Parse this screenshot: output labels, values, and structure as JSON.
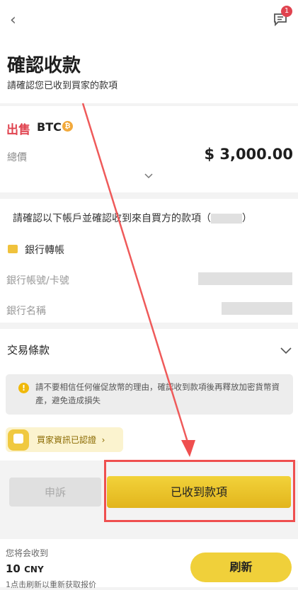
{
  "header": {
    "back_glyph": "‹",
    "chat_badge": "1"
  },
  "page": {
    "title": "確認收款",
    "subtitle": "請確認您已收到買家的款項"
  },
  "order": {
    "side": "出售",
    "coin": "BTC",
    "coin_symbol": "₿",
    "total_label": "總價",
    "total_value": "$  3,000.00"
  },
  "payment": {
    "confirm_text": "請確認以下帳戶並確認收到來自買方的款項（",
    "confirm_text_end": "）",
    "method": "銀行轉帳",
    "account_label": "銀行帳號/卡號",
    "bank_name_label": "銀行名稱"
  },
  "terms": {
    "label": "交易條款"
  },
  "notice": {
    "icon_glyph": "!",
    "text": "請不要相信任何催促放幣的理由，確認收到款項後再釋放加密貨幣資產，避免造成損失"
  },
  "verified": {
    "label": "買家資訊已認證",
    "arrow": "›"
  },
  "actions": {
    "appeal_label": "申訴",
    "received_label": "已收到款項"
  },
  "footer": {
    "receive_label": "您将会收到",
    "amount": "10",
    "currency": "CNY",
    "refresh_note": "1点击刷新以重新获取报价",
    "refresh_label": "刷新"
  },
  "colors": {
    "accent": "#f0c940",
    "sell": "#e0434f",
    "annotation": "#ef4f4f"
  }
}
